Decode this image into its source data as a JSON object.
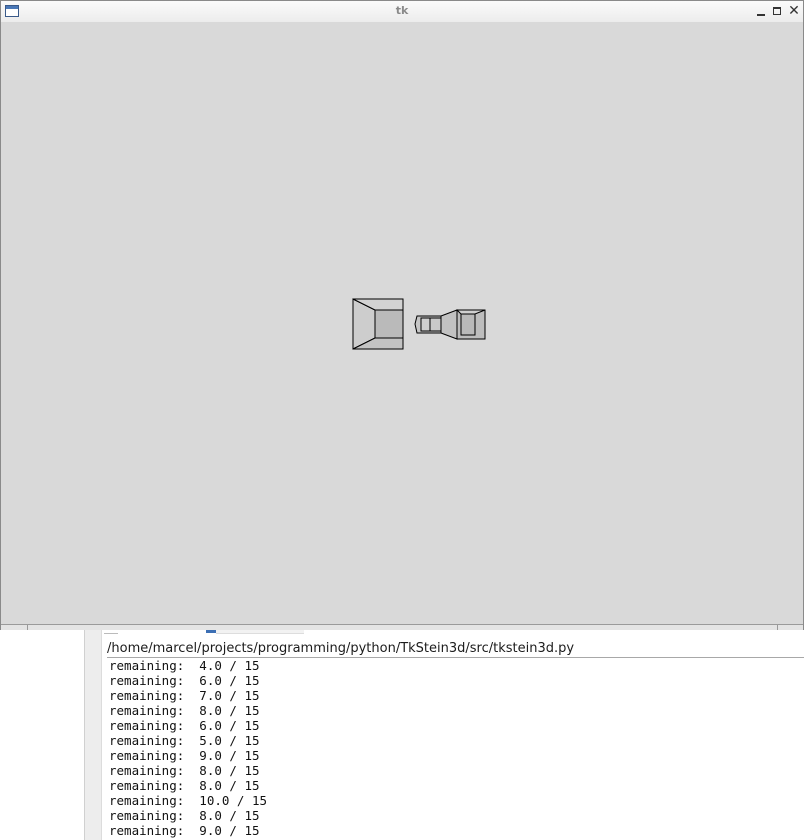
{
  "window": {
    "title": "tk",
    "icons": {
      "app": "window-app-icon",
      "minimize": "minimize-icon",
      "maximize": "maximize-icon",
      "close": "close-icon"
    },
    "close_glyph": "✕"
  },
  "canvas": {
    "background": "#d9d9d9",
    "shape_fill": "#bfbfbf",
    "shape_stroke": "#000000"
  },
  "console": {
    "path": "/home/marcel/projects/programming/python/TkStein3d/src/tkstein3d.py",
    "lines": [
      "remaining:  4.0 / 15",
      "remaining:  6.0 / 15",
      "remaining:  7.0 / 15",
      "remaining:  8.0 / 15",
      "remaining:  6.0 / 15",
      "remaining:  5.0 / 15",
      "remaining:  9.0 / 15",
      "remaining:  8.0 / 15",
      "remaining:  8.0 / 15",
      "remaining:  10.0 / 15",
      "remaining:  8.0 / 15",
      "remaining:  9.0 / 15"
    ]
  }
}
